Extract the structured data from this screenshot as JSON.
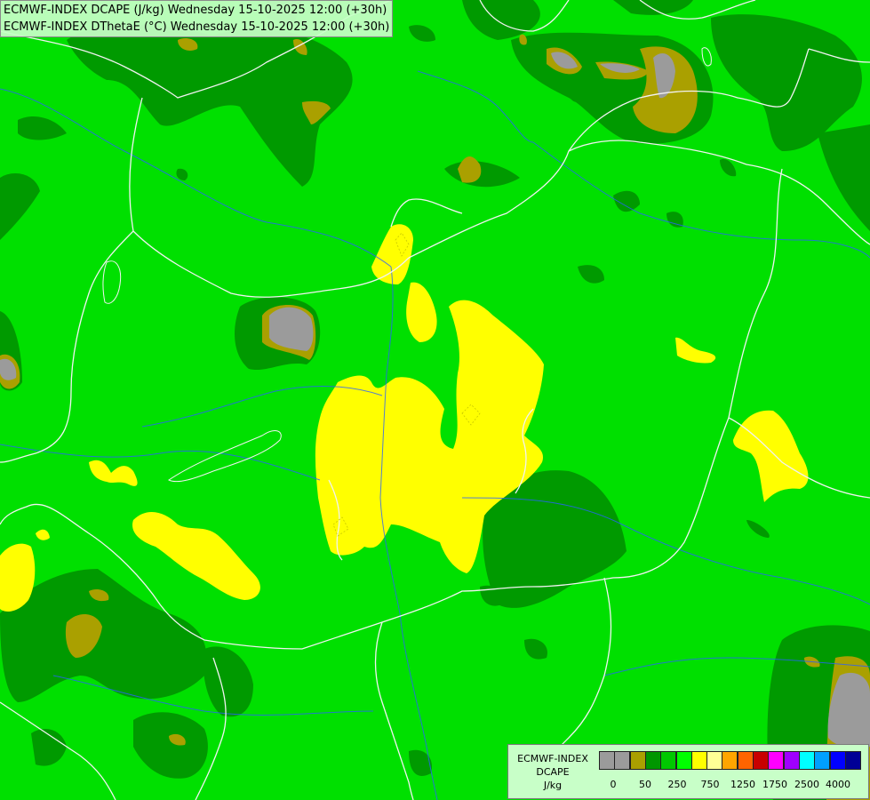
{
  "map": {
    "title_line1": "ECMWF-INDEX DCAPE (J/kg) Wednesday 15-10-2025 12:00 (+30h)",
    "title_line2": "ECMWF-INDEX DThetaE (°C) Wednesday 15-10-2025 12:00 (+30h)"
  },
  "legend": {
    "line1": "ECMWF-INDEX",
    "line2": "DCAPE",
    "line3": "J/kg",
    "colors": [
      "#9b9b9b",
      "#9b9b9b",
      "#aaa000",
      "#009600",
      "#00c800",
      "#00ff00",
      "#ffff00",
      "#ffff96",
      "#ffa500",
      "#ff6400",
      "#c80000",
      "#ff00ff",
      "#a000ff",
      "#00ffff",
      "#00a0ff",
      "#0000ff",
      "#000096"
    ],
    "ticks": [
      "0",
      "50",
      "250",
      "750",
      "1250",
      "1750",
      "2500",
      "4000"
    ]
  }
}
